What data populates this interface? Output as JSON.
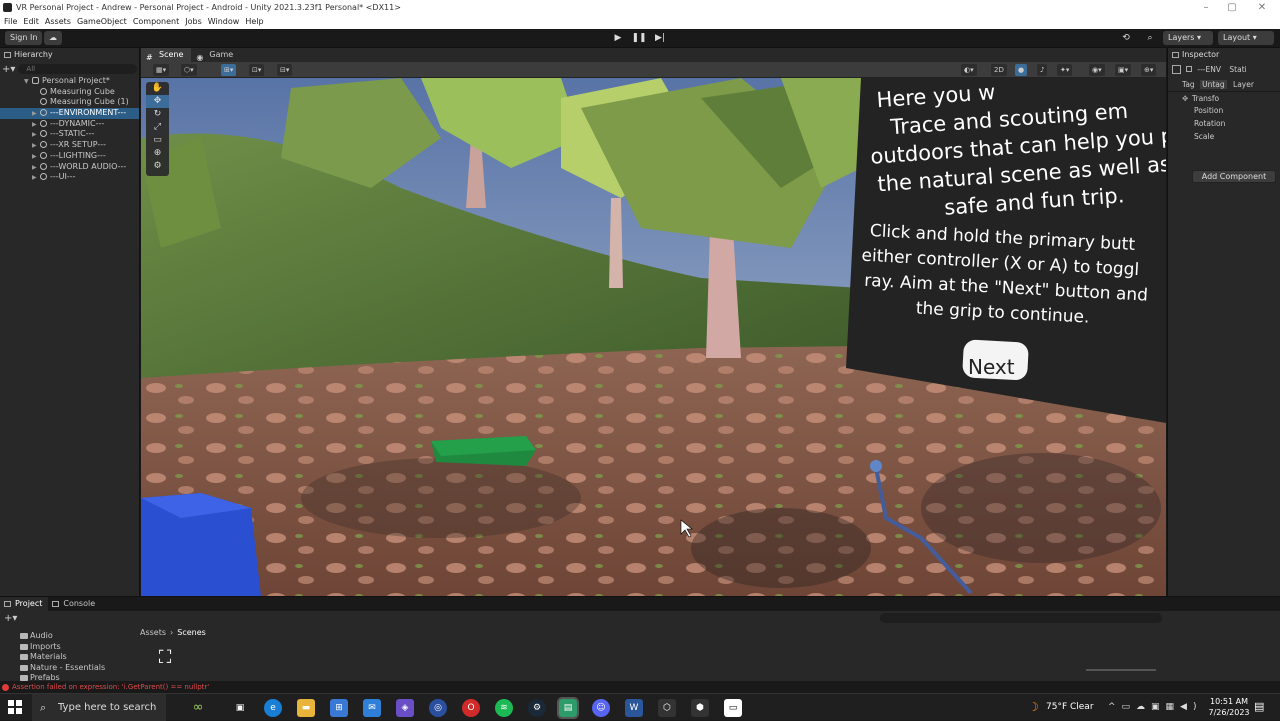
{
  "window": {
    "title": "VR Personal Project - Andrew - Personal Project - Android - Unity 2021.3.23f1 Personal* <DX11>"
  },
  "menu": [
    "File",
    "Edit",
    "Assets",
    "GameObject",
    "Component",
    "Jobs",
    "Window",
    "Help"
  ],
  "toolbar": {
    "sign_in": "Sign In",
    "layers": "Layers",
    "layout": "Layout"
  },
  "hierarchy": {
    "tab": "Hierarchy",
    "search_placeholder": "All",
    "scene": "Personal Project*",
    "items": [
      "Measuring Cube",
      "Measuring Cube (1)",
      "---ENVIRONMENT---",
      "---DYNAMIC---",
      "---STATIC---",
      "---XR SETUP---",
      "---LIGHTING---",
      "---WORLD AUDIO---",
      "---UI---"
    ]
  },
  "scene_tabs": {
    "scene": "Scene",
    "game": "Game"
  },
  "scene_toolbar": {
    "two_d": "2D"
  },
  "viewport": {
    "panel_text_top": [
      "Here you w",
      "Trace and scouting em",
      "outdoors that can help you p",
      "the natural scene as well as",
      "safe and fun trip."
    ],
    "panel_text_bottom": [
      "Click and hold the primary butt",
      "either controller (X or A) to toggl",
      "ray. Aim at the \"Next\" button and",
      "the grip to continue."
    ],
    "next_button": "Next"
  },
  "inspector": {
    "tab": "Inspector",
    "object_name": "---ENV",
    "static_label": "Stati",
    "tag_label": "Tag",
    "tag_value": "Untag",
    "layer_label": "Layer",
    "transform": "Transfo",
    "position": "Position",
    "rotation": "Rotation",
    "scale": "Scale",
    "add_component": "Add Component"
  },
  "project": {
    "tab_project": "Project",
    "tab_console": "Console",
    "folders": [
      "Audio",
      "Imports",
      "Materials",
      "Nature - Essentials",
      "Prefabs"
    ],
    "breadcrumb": [
      "Assets",
      "Scenes"
    ]
  },
  "status": {
    "error": "Assertion failed on expression: 'i.GetParent() == nullptr'"
  },
  "taskbar": {
    "search": "Type here to search",
    "weather": "75°F  Clear",
    "time": "10:51 AM",
    "date": "7/26/2023"
  },
  "colors": {
    "selection": "#2c5d87",
    "ground": "#8a5a48",
    "grass": "#5a7a3a",
    "green_block": "#1f8a3f",
    "blue_cube": "#2a4fd0"
  }
}
